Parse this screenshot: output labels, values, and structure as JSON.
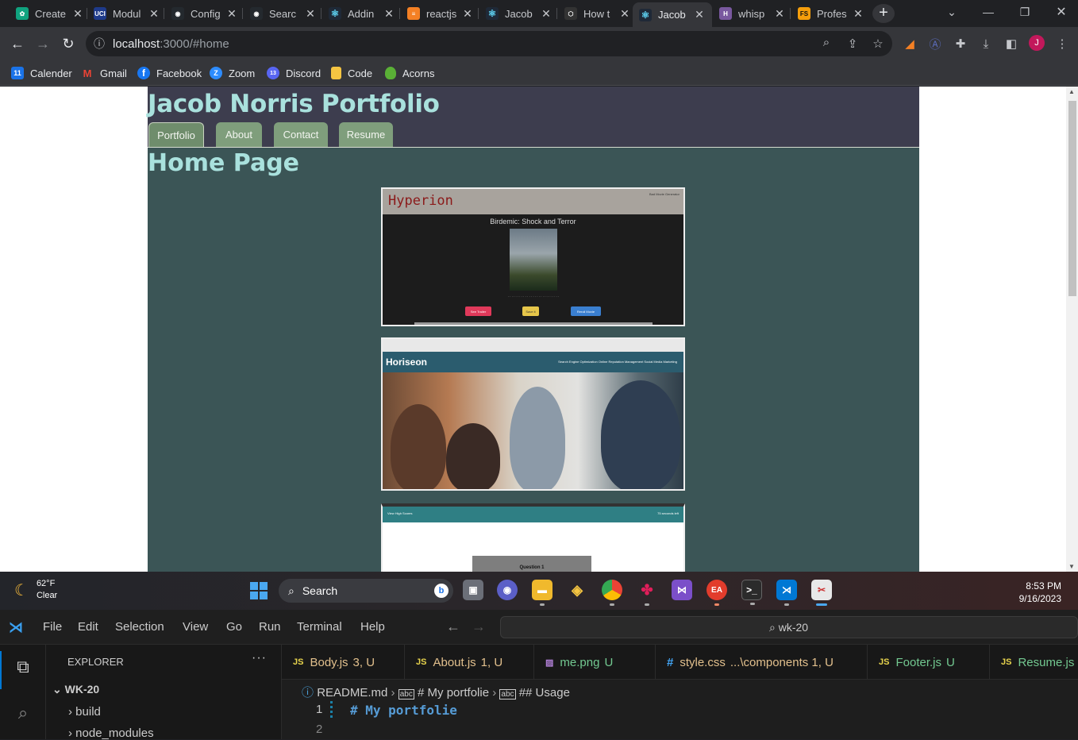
{
  "browser": {
    "tabs": [
      {
        "title": "Create",
        "icon": "chatgpt-icon",
        "color": "#10a37f",
        "glyph": "✿"
      },
      {
        "title": "Modul",
        "icon": "uci-icon",
        "color": "#1e3a8a",
        "glyph": "UCI"
      },
      {
        "title": "Config",
        "icon": "github-icon",
        "color": "#24292e",
        "glyph": "◉"
      },
      {
        "title": "Searc",
        "icon": "github-icon",
        "color": "#24292e",
        "glyph": "◉"
      },
      {
        "title": "Addin",
        "icon": "react-icon",
        "color": "#1f2937",
        "glyph": "⚛"
      },
      {
        "title": "reactjs",
        "icon": "stackoverflow-icon",
        "color": "#f48024",
        "glyph": "≡"
      },
      {
        "title": "Jacob",
        "icon": "react-icon",
        "color": "#1f2937",
        "glyph": "⚛"
      },
      {
        "title": "How t",
        "icon": "codesandbox-icon",
        "color": "#333",
        "glyph": "⬡"
      },
      {
        "title": "Jacob",
        "icon": "react-icon",
        "color": "#1f2937",
        "glyph": "⚛"
      },
      {
        "title": "whisp",
        "icon": "heroku-icon",
        "color": "#79589f",
        "glyph": "H"
      },
      {
        "title": "Profes",
        "icon": "fs-icon",
        "color": "#f59e0b",
        "glyph": "FS"
      }
    ],
    "new_tab": "+",
    "url_host": "localhost",
    "url_rest": ":3000/#home",
    "profile_initial": "J",
    "bookmarks": [
      {
        "label": "Calender",
        "icon": "calendar-icon",
        "color": "#1a73e8",
        "glyph": "11"
      },
      {
        "label": "Gmail",
        "icon": "gmail-icon",
        "color": "#35363a",
        "glyph": "M"
      },
      {
        "label": "Facebook",
        "icon": "facebook-icon",
        "color": "#1877f2",
        "glyph": "f"
      },
      {
        "label": "Zoom",
        "icon": "zoom-icon",
        "color": "#2d8cff",
        "glyph": "Z"
      },
      {
        "label": "Discord",
        "icon": "discord-icon",
        "color": "#5865f2",
        "glyph": "13"
      },
      {
        "label": "Code",
        "icon": "folder-icon",
        "color": "#f5c542",
        "glyph": ""
      },
      {
        "label": "Acorns",
        "icon": "acorns-icon",
        "color": "#5ab036",
        "glyph": ""
      }
    ]
  },
  "site": {
    "title": "Jacob Norris Portfolio",
    "nav": [
      "Portfolio",
      "About",
      "Contact",
      "Resume"
    ],
    "active_nav": "Portfolio",
    "heading": "Home Page",
    "projects": {
      "hyperion": {
        "brand": "Hyperion",
        "generator": "Bad Movie Generator",
        "movie": "Birdemic: Shock and Terror",
        "buttons": [
          "See Trailer",
          "Save it",
          "Reroll Movie"
        ]
      },
      "horiseon": {
        "brand": "Horiseon",
        "links": "Search Engine Optimization    Online Reputation Management    Social Media Marketing"
      },
      "quiz": {
        "left": "View High Scores",
        "right": "75 seconds left",
        "question": "Question 1"
      }
    }
  },
  "taskbar": {
    "temp": "62°F",
    "condition": "Clear",
    "search": "Search",
    "time": "8:53 PM",
    "date": "9/16/2023"
  },
  "vscode": {
    "menu": [
      "File",
      "Edit",
      "Selection",
      "View",
      "Go",
      "Run",
      "Terminal",
      "Help"
    ],
    "command_center": "wk-20",
    "explorer_title": "EXPLORER",
    "root": "WK-20",
    "tree": [
      "build",
      "node_modules"
    ],
    "tabs": [
      {
        "icon": "JS",
        "name": "Body.js",
        "status": "3, U"
      },
      {
        "icon": "JS",
        "name": "About.js",
        "status": "1, U"
      },
      {
        "icon": "IMG",
        "name": "me.png",
        "status": "U"
      },
      {
        "icon": "#",
        "name": "style.css",
        "status": "...\\components  1, U"
      },
      {
        "icon": "JS",
        "name": "Footer.js",
        "status": "U"
      },
      {
        "icon": "JS",
        "name": "Resume.js",
        "status": ""
      }
    ],
    "breadcrumb": [
      "README.md",
      "# My portfolie",
      "## Usage"
    ],
    "lines": [
      "1",
      "2"
    ],
    "code_line": "# My portfolie"
  }
}
